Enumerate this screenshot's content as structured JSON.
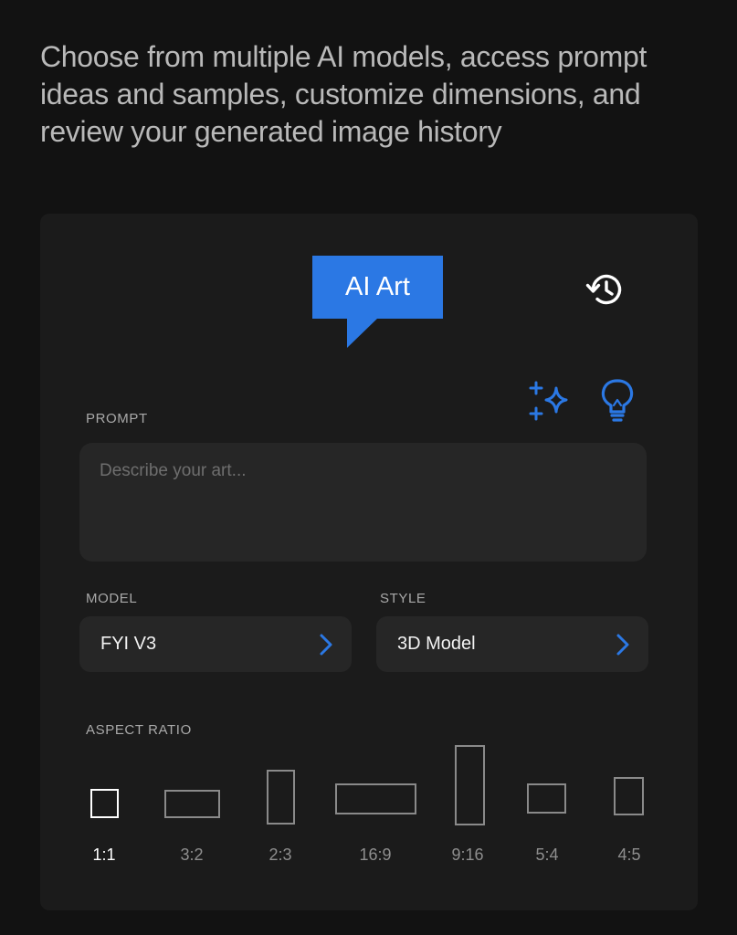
{
  "headline": "Choose from multiple AI models, access prompt ideas and samples, customize dimensions, and review your generated image history",
  "badge": {
    "label": "AI Art"
  },
  "icons": {
    "history": "history-icon",
    "sparkle": "sparkle-icon",
    "bulb": "lightbulb-icon",
    "chevron": "chevron-right-icon"
  },
  "colors": {
    "accent": "#2b78e4",
    "card": "#1b1b1b",
    "field": "#262626",
    "background": "#121212"
  },
  "prompt": {
    "label": "PROMPT",
    "placeholder": "Describe your art...",
    "value": ""
  },
  "model": {
    "label": "MODEL",
    "value": "FYI V3"
  },
  "style": {
    "label": "STYLE",
    "value": "3D Model"
  },
  "aspect": {
    "label": "ASPECT RATIO",
    "selected": "1:1",
    "options": [
      "1:1",
      "3:2",
      "2:3",
      "16:9",
      "9:16",
      "5:4",
      "4:5"
    ]
  }
}
